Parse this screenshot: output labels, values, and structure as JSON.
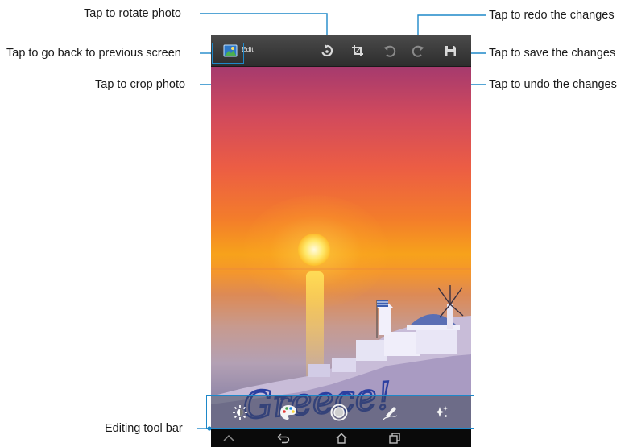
{
  "app_bar": {
    "title": "Edit",
    "icons": [
      "gallery-thumb-icon",
      "rotate-icon",
      "crop-icon",
      "undo-icon",
      "redo-icon",
      "save-icon"
    ]
  },
  "callouts": {
    "rotate": "Tap to rotate photo",
    "back": "Tap to go back to previous screen",
    "crop": "Tap to crop photo",
    "redo": "Tap to redo the changes",
    "save": "Tap to save the changes",
    "undo": "Tap to undo the changes",
    "toolbar": "Editing tool bar"
  },
  "photo": {
    "handwriting": "Greece!"
  },
  "editing_tools": [
    "brightness-icon",
    "palette-icon",
    "frame-icon",
    "pen-icon",
    "effects-icon"
  ],
  "nav_buttons": [
    "back-nav-icon",
    "home-nav-icon",
    "recents-nav-icon"
  ],
  "colors": {
    "callout_line": "#1e88c9",
    "app_bar": "#3a3a3a",
    "icon": "#d9d9d9"
  }
}
